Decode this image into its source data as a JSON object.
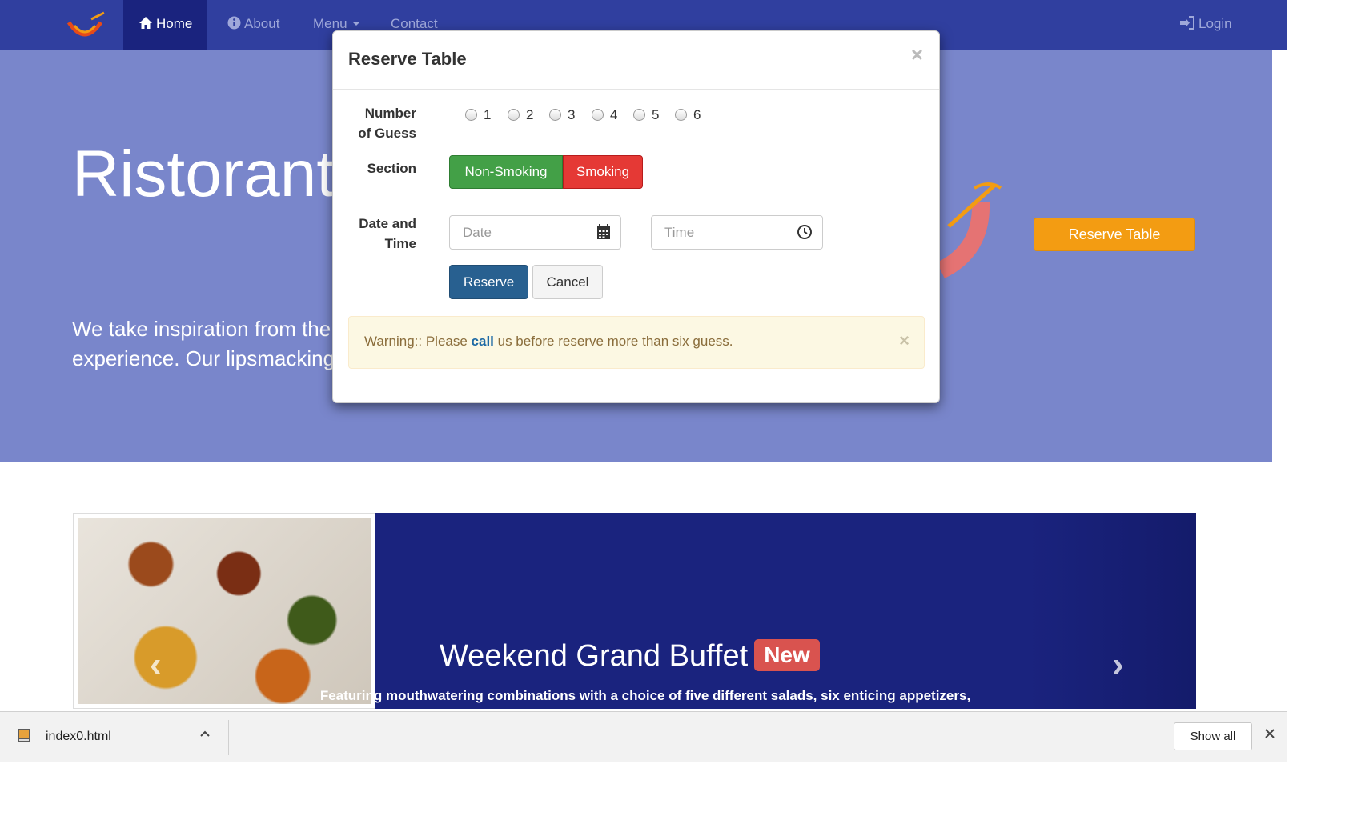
{
  "navbar": {
    "items": [
      {
        "label": "Home",
        "icon": "home-icon"
      },
      {
        "label": "About",
        "icon": "info-circle-icon"
      },
      {
        "label": "Menu",
        "icon": "caret-down-icon"
      },
      {
        "label": "Contact"
      }
    ],
    "login": "Login"
  },
  "jumbotron": {
    "title": "Ristorante",
    "text": "We take inspiration from the",
    "text2": "experience. Our lipsmacking",
    "reserve_button": "Reserve Table"
  },
  "modal": {
    "title": "Reserve Table",
    "close": "×",
    "guests_label_1": "Number",
    "guests_label_2": "of Guess",
    "guest_options": [
      "1",
      "2",
      "3",
      "4",
      "5",
      "6"
    ],
    "section_label": "Section",
    "section_options": [
      "Non-Smoking",
      "Smoking"
    ],
    "datetime_label_1": "Date and",
    "datetime_label_2": "Time",
    "date_placeholder": "Date",
    "time_placeholder": "Time",
    "reserve_button": "Reserve",
    "cancel_button": "Cancel",
    "alert": {
      "prefix": "Warning:: Please ",
      "link": "call",
      "suffix": " us before reserve more than six guess.",
      "close": "×"
    }
  },
  "carousel": {
    "title": "Weekend Grand Buffet",
    "badge": "New",
    "caption": "Featuring mouthwatering combinations with a choice of five different salads, six enticing appetizers, six"
  },
  "downloads": {
    "file": "index0.html",
    "show_all": "Show all"
  },
  "colors": {
    "navbar": "#303F9F",
    "jumbotron": "#7986CB",
    "accent": "#F39C12",
    "carousel": "#1A237E"
  }
}
